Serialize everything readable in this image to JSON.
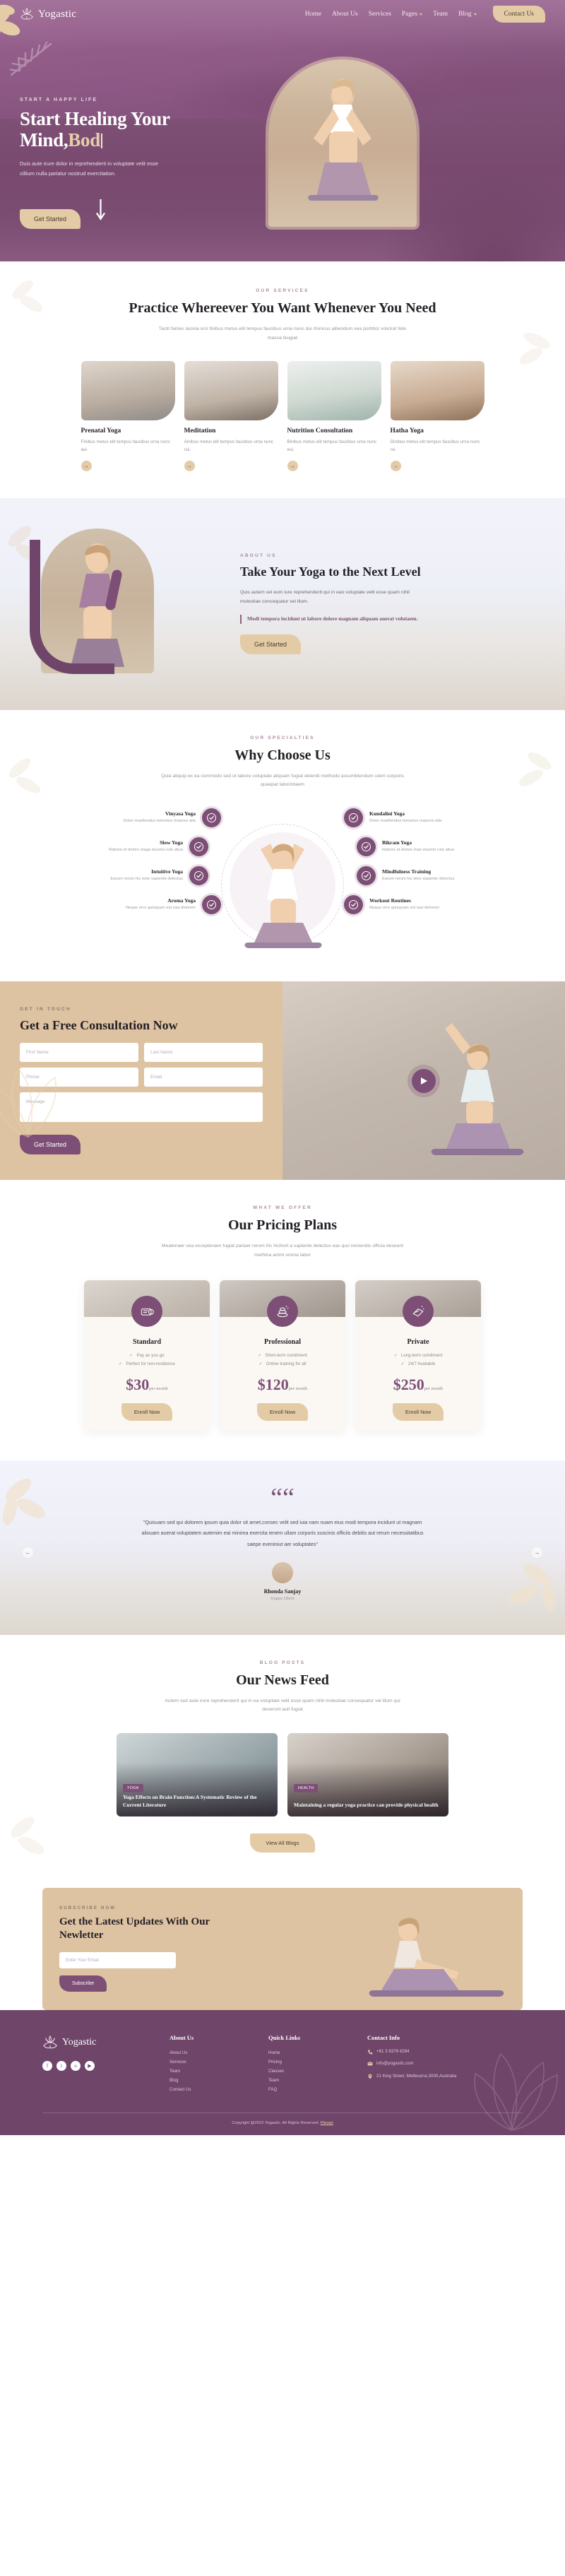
{
  "brand": {
    "name": "Yogastic",
    "logo_icon": "lotus-icon"
  },
  "nav": {
    "items": [
      {
        "label": "Home",
        "has_dropdown": false
      },
      {
        "label": "About Us",
        "has_dropdown": false
      },
      {
        "label": "Services",
        "has_dropdown": false
      },
      {
        "label": "Pages",
        "has_dropdown": true
      },
      {
        "label": "Team",
        "has_dropdown": false
      },
      {
        "label": "Blog",
        "has_dropdown": true
      }
    ],
    "cta": "Contact Us"
  },
  "hero": {
    "eyebrow": "START A HAPPY LIFE",
    "title_line1": "Start Healing Your",
    "title_line2_plain": "Mind,",
    "title_line2_gold": "Bod",
    "paragraph": "Duis aute irure dolor in reprehenderit in voluptate velit esse cillium nulla pariatur nostrud exercitation.",
    "cta": "Get Started",
    "scroll_icon": "down-arrow-icon"
  },
  "services": {
    "eyebrow": "OUR SERVICES",
    "title": "Practice Whereever You Want Whenever You Need",
    "subtitle": "Taciti fames lacinia orci finibus metus elit tempus faucibus urna nunc dui rhoncus aibendum vea porttitor volutrat felis massa feugiat",
    "cards": [
      {
        "title": "Prenatal Yoga",
        "text": "Finibus metus elit tempus faucibus urna nunc aui.",
        "arrow_icon": "arrow-right-icon"
      },
      {
        "title": "Meditation",
        "text": "Ainibus metus elit tempus faucibus urna nunc cui.",
        "arrow_icon": "arrow-right-icon"
      },
      {
        "title": "Nutrition Consultation",
        "text": "Binibus metus elit tempus faucibus urna nunc eui.",
        "arrow_icon": "arrow-right-icon"
      },
      {
        "title": "Hatha Yoga",
        "text": "Dinibus metus elit tempus faucibus urna nunc rui.",
        "arrow_icon": "arrow-right-icon"
      }
    ]
  },
  "about": {
    "eyebrow": "ABOUT US",
    "title": "Take Your Yoga to the Next Level",
    "paragraph": "Quis autem vel eum iure reprehenderit qui in eao voluptate velit esse quam nihil molestiae consequatur vel illum.",
    "quote": "Modi tempora incidunt ut labore dolore magnam aliquam auerat volutaem.",
    "cta": "Get Started"
  },
  "specialties": {
    "eyebrow": "OUR SPECIALTIES",
    "title": "Why Choose Us",
    "subtitle": "Quia aliquip ex ea commodo sed ut labore voluptate aliquam fugiat deleniti methodo assumblendum utem corporis quaepat laborintaem",
    "left": [
      {
        "name": "Vinyasa Yoga",
        "desc": "Dolor reaellendus temorius maiores alia",
        "icon": "check-circle-icon"
      },
      {
        "name": "Slow Yoga",
        "desc": "Rabore et dolore maga eiusmo rute aliua",
        "icon": "check-circle-icon"
      },
      {
        "name": "Intuitive Yoga",
        "desc": "Earum rerum hic tene sapiente delectus",
        "icon": "check-circle-icon"
      },
      {
        "name": "Aroma Yoga",
        "desc": "Neque orro quisquam est raui dolorem",
        "icon": "check-circle-icon"
      }
    ],
    "right": [
      {
        "name": "Kundalini Yoga",
        "desc": "Dolor reaellendus temorius maiores alia",
        "icon": "check-circle-icon"
      },
      {
        "name": "Bikram Yoga",
        "desc": "Rabore et dolore mae eiusmo rute aliua",
        "icon": "check-circle-icon"
      },
      {
        "name": "Mindfulness Training",
        "desc": "Earum rerum hic tene sapiente delectus",
        "icon": "check-circle-icon"
      },
      {
        "name": "Workout Routines",
        "desc": "Neque orro quisquam est raui dolorem",
        "icon": "check-circle-icon"
      }
    ]
  },
  "consultation": {
    "eyebrow": "GET IN TOUCH",
    "title": "Get a Free Consultation Now",
    "fields": {
      "first_name": "First Name",
      "last_name": "Last Name",
      "phone": "Phone",
      "email": "Email",
      "message": "Message"
    },
    "cta": "Get Started",
    "play_icon": "play-icon"
  },
  "pricing": {
    "eyebrow": "WHAT WE OFFER",
    "title": "Our Pricing Plans",
    "subtitle": "Meatenaer vea excepteraen fugiat pariaer rerum hic hicllorit a sapiente delectus eas quo reiciendis officia deseunt methina animi omnia labor",
    "plans": [
      {
        "name": "Standard",
        "icon": "mat-icon",
        "features": [
          "Pay as you go",
          "Perfect for non-residence"
        ],
        "price": "$30",
        "period": "per month",
        "cta": "Enroll Now"
      },
      {
        "name": "Professional",
        "icon": "stones-icon",
        "features": [
          "Short-term comitment",
          "Online training for all"
        ],
        "price": "$120",
        "period": "per month",
        "cta": "Enroll Now"
      },
      {
        "name": "Private",
        "icon": "towel-icon",
        "features": [
          "Long-term comitment",
          "24/7 Available"
        ],
        "price": "$250",
        "period": "per month",
        "cta": "Enroll Now"
      }
    ]
  },
  "testimonial": {
    "quote_icon": "quote-mark-icon",
    "text": "\"Quisuam sed qui dolorem ipsum quia dolor sit amet,consec velit sed iuia nam nuam eius modi tempora incidunt ut magnam aliouam auerat voluptatem autemim eai minima exercita ienem ullam corporis suscinis officiis debitis aut rerum necessitatibus saepe eveniniut aer voluptates\"",
    "avatar": "user-avatar",
    "name": "Rhonda Sanjay",
    "role": "Happy Client",
    "prev_icon": "arrow-left-icon",
    "next_icon": "arrow-right-icon"
  },
  "blog": {
    "eyebrow": "BLOG POSTS",
    "title": "Our News Feed",
    "subtitle": "Autem sed aute irure reprehenderit qui in ea voluptate velit esse quam nihil molestiae consequatur vel illum qui deserunt auit fugiat",
    "posts": [
      {
        "tag": "YOGA",
        "title": "Yoga Effects on Brain Function:A Systematic Review of the Current Literature"
      },
      {
        "tag": "HEALTH",
        "title": "Maintaining a regular yoga practice can provide physical health"
      }
    ],
    "cta": "View All Blogs"
  },
  "newsletter": {
    "eyebrow": "SUBSCRIBE NOW",
    "title": "Get the Latest Updates With Our Newletter",
    "placeholder": "Enter Your Email",
    "cta": "Subscribe"
  },
  "footer": {
    "brand": "Yogastic",
    "about": {
      "title": "About Us",
      "links": [
        "About Us",
        "Services",
        "Team",
        "Blog",
        "Contact Us"
      ]
    },
    "quick": {
      "title": "Quick Links",
      "links": [
        "Home",
        "Pricing",
        "Classes",
        "Team",
        "FAQ"
      ]
    },
    "contact": {
      "title": "Contact Info",
      "phone": "+61 3 8376 6284",
      "email": "info@yogastic.com",
      "address": "21 King Street, Melbourne,3000,Australia",
      "phone_icon": "phone-icon",
      "email_icon": "mail-icon",
      "address_icon": "pin-icon"
    },
    "socials": [
      {
        "name": "facebook-icon",
        "glyph": "f"
      },
      {
        "name": "twitter-icon",
        "glyph": "t"
      },
      {
        "name": "instagram-icon",
        "glyph": "o"
      },
      {
        "name": "youtube-icon",
        "glyph": "▶"
      }
    ],
    "copyright": "Copyright @2022 Yogastic. All Rights Reserved.",
    "credit": "Plexart"
  },
  "colors": {
    "purple": "#7d4f76",
    "deep_purple": "#6f4569",
    "gold": "#e3cba6",
    "sand": "#ddc3a1",
    "ink": "#241f26"
  }
}
